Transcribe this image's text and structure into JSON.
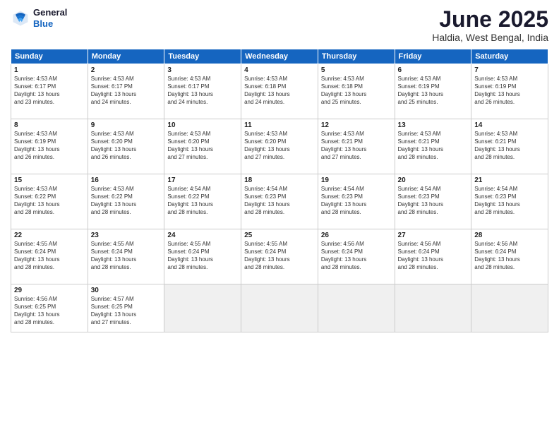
{
  "header": {
    "logo_line1": "General",
    "logo_line2": "Blue",
    "title": "June 2025",
    "location": "Haldia, West Bengal, India"
  },
  "days_of_week": [
    "Sunday",
    "Monday",
    "Tuesday",
    "Wednesday",
    "Thursday",
    "Friday",
    "Saturday"
  ],
  "weeks": [
    [
      {
        "day": 1,
        "info": "Sunrise: 4:53 AM\nSunset: 6:17 PM\nDaylight: 13 hours\nand 23 minutes."
      },
      {
        "day": 2,
        "info": "Sunrise: 4:53 AM\nSunset: 6:17 PM\nDaylight: 13 hours\nand 24 minutes."
      },
      {
        "day": 3,
        "info": "Sunrise: 4:53 AM\nSunset: 6:17 PM\nDaylight: 13 hours\nand 24 minutes."
      },
      {
        "day": 4,
        "info": "Sunrise: 4:53 AM\nSunset: 6:18 PM\nDaylight: 13 hours\nand 24 minutes."
      },
      {
        "day": 5,
        "info": "Sunrise: 4:53 AM\nSunset: 6:18 PM\nDaylight: 13 hours\nand 25 minutes."
      },
      {
        "day": 6,
        "info": "Sunrise: 4:53 AM\nSunset: 6:19 PM\nDaylight: 13 hours\nand 25 minutes."
      },
      {
        "day": 7,
        "info": "Sunrise: 4:53 AM\nSunset: 6:19 PM\nDaylight: 13 hours\nand 26 minutes."
      }
    ],
    [
      {
        "day": 8,
        "info": "Sunrise: 4:53 AM\nSunset: 6:19 PM\nDaylight: 13 hours\nand 26 minutes."
      },
      {
        "day": 9,
        "info": "Sunrise: 4:53 AM\nSunset: 6:20 PM\nDaylight: 13 hours\nand 26 minutes."
      },
      {
        "day": 10,
        "info": "Sunrise: 4:53 AM\nSunset: 6:20 PM\nDaylight: 13 hours\nand 27 minutes."
      },
      {
        "day": 11,
        "info": "Sunrise: 4:53 AM\nSunset: 6:20 PM\nDaylight: 13 hours\nand 27 minutes."
      },
      {
        "day": 12,
        "info": "Sunrise: 4:53 AM\nSunset: 6:21 PM\nDaylight: 13 hours\nand 27 minutes."
      },
      {
        "day": 13,
        "info": "Sunrise: 4:53 AM\nSunset: 6:21 PM\nDaylight: 13 hours\nand 28 minutes."
      },
      {
        "day": 14,
        "info": "Sunrise: 4:53 AM\nSunset: 6:21 PM\nDaylight: 13 hours\nand 28 minutes."
      }
    ],
    [
      {
        "day": 15,
        "info": "Sunrise: 4:53 AM\nSunset: 6:22 PM\nDaylight: 13 hours\nand 28 minutes."
      },
      {
        "day": 16,
        "info": "Sunrise: 4:53 AM\nSunset: 6:22 PM\nDaylight: 13 hours\nand 28 minutes."
      },
      {
        "day": 17,
        "info": "Sunrise: 4:54 AM\nSunset: 6:22 PM\nDaylight: 13 hours\nand 28 minutes."
      },
      {
        "day": 18,
        "info": "Sunrise: 4:54 AM\nSunset: 6:23 PM\nDaylight: 13 hours\nand 28 minutes."
      },
      {
        "day": 19,
        "info": "Sunrise: 4:54 AM\nSunset: 6:23 PM\nDaylight: 13 hours\nand 28 minutes."
      },
      {
        "day": 20,
        "info": "Sunrise: 4:54 AM\nSunset: 6:23 PM\nDaylight: 13 hours\nand 28 minutes."
      },
      {
        "day": 21,
        "info": "Sunrise: 4:54 AM\nSunset: 6:23 PM\nDaylight: 13 hours\nand 28 minutes."
      }
    ],
    [
      {
        "day": 22,
        "info": "Sunrise: 4:55 AM\nSunset: 6:24 PM\nDaylight: 13 hours\nand 28 minutes."
      },
      {
        "day": 23,
        "info": "Sunrise: 4:55 AM\nSunset: 6:24 PM\nDaylight: 13 hours\nand 28 minutes."
      },
      {
        "day": 24,
        "info": "Sunrise: 4:55 AM\nSunset: 6:24 PM\nDaylight: 13 hours\nand 28 minutes."
      },
      {
        "day": 25,
        "info": "Sunrise: 4:55 AM\nSunset: 6:24 PM\nDaylight: 13 hours\nand 28 minutes."
      },
      {
        "day": 26,
        "info": "Sunrise: 4:56 AM\nSunset: 6:24 PM\nDaylight: 13 hours\nand 28 minutes."
      },
      {
        "day": 27,
        "info": "Sunrise: 4:56 AM\nSunset: 6:24 PM\nDaylight: 13 hours\nand 28 minutes."
      },
      {
        "day": 28,
        "info": "Sunrise: 4:56 AM\nSunset: 6:24 PM\nDaylight: 13 hours\nand 28 minutes."
      }
    ],
    [
      {
        "day": 29,
        "info": "Sunrise: 4:56 AM\nSunset: 6:25 PM\nDaylight: 13 hours\nand 28 minutes."
      },
      {
        "day": 30,
        "info": "Sunrise: 4:57 AM\nSunset: 6:25 PM\nDaylight: 13 hours\nand 27 minutes."
      },
      null,
      null,
      null,
      null,
      null
    ]
  ]
}
